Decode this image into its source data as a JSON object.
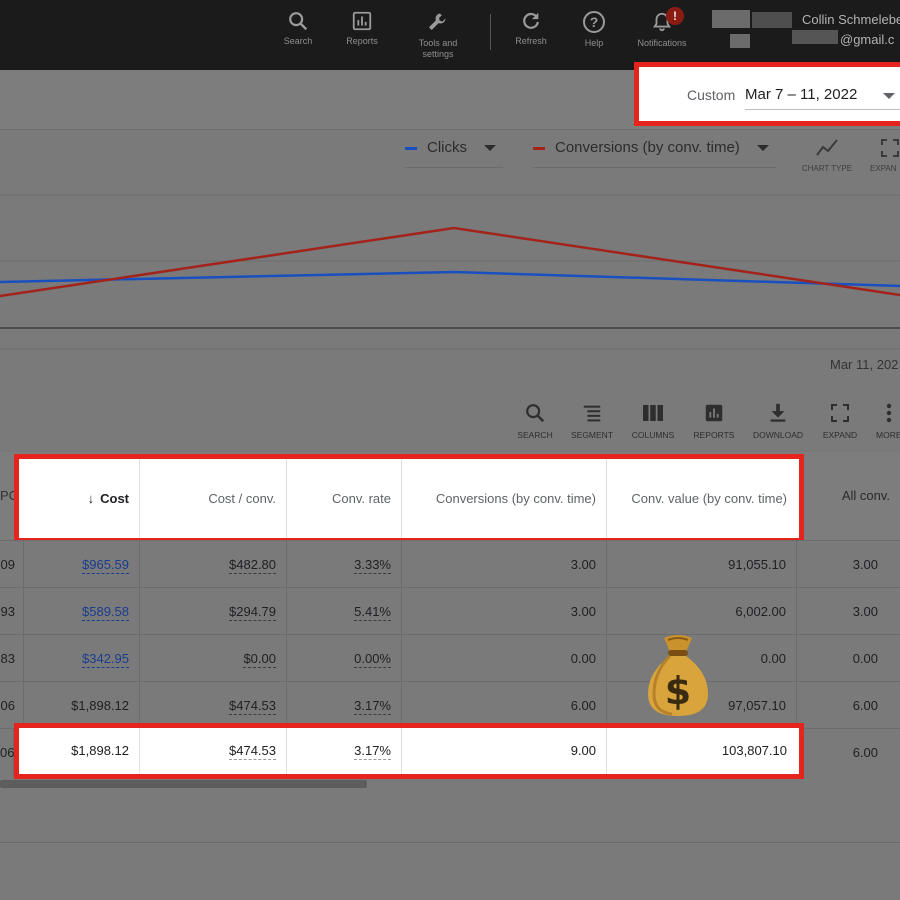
{
  "toolbar": {
    "search_label": "Search",
    "reports_label": "Reports",
    "tools_label_line1": "Tools and",
    "tools_label_line2": "settings",
    "refresh_label": "Refresh",
    "help_label": "Help",
    "notifications_label": "Notifications",
    "notifications_badge": "!",
    "account_name": "Collin Schmelebe",
    "account_email": "@gmail.c"
  },
  "date_range": {
    "preset": "Custom",
    "value": "Mar 7 – 11, 2022"
  },
  "chart_header": {
    "metric1": "Clicks",
    "metric1_color": "#1a4fbf",
    "metric2": "Conversions (by conv. time)",
    "metric2_color": "#a3231b",
    "chart_type_label": "CHART TYPE",
    "expand_label": "EXPAN"
  },
  "chart_data": {
    "type": "line",
    "x_end_label": "Mar 11, 202",
    "series": [
      {
        "name": "Clicks",
        "color": "#1a4fbf"
      },
      {
        "name": "Conversions (by conv. time)",
        "color": "#a3231b"
      }
    ]
  },
  "table_toolbar": {
    "search": "SEARCH",
    "segment": "SEGMENT",
    "columns": "COLUMNS",
    "reports": "REPORTS",
    "download": "DOWNLOAD",
    "expand": "EXPAND",
    "more": "MORE"
  },
  "table": {
    "left_cut_header": "PC",
    "headers": {
      "cost": "Cost",
      "cost_conv": "Cost / conv.",
      "conv_rate": "Conv. rate",
      "conversions": "Conversions (by conv. time)",
      "conv_value": "Conv. value (by conv. time)",
      "all_conv": "All conv."
    },
    "rows": [
      {
        "cut": "09",
        "cost": "$965.59",
        "cost_conv": "$482.80",
        "conv_rate": "3.33%",
        "conversions": "3.00",
        "conv_value": "91,055.10",
        "all_conv": "3.00"
      },
      {
        "cut": "93",
        "cost": "$589.58",
        "cost_conv": "$294.79",
        "conv_rate": "5.41%",
        "conversions": "3.00",
        "conv_value": "6,002.00",
        "all_conv": "3.00"
      },
      {
        "cut": "83",
        "cost": "$342.95",
        "cost_conv": "$0.00",
        "conv_rate": "0.00%",
        "conversions": "0.00",
        "conv_value": "0.00",
        "all_conv": "0.00"
      },
      {
        "cut": "06",
        "cost": "$1,898.12",
        "cost_conv": "$474.53",
        "conv_rate": "3.17%",
        "conversions": "6.00",
        "conv_value": "97,057.10",
        "all_conv": "6.00"
      }
    ],
    "total_row": {
      "cut": "06",
      "cost": "$1,898.12",
      "cost_conv": "$474.53",
      "conv_rate": "3.17%",
      "conversions": "9.00",
      "conv_value": "103,807.10",
      "all_conv": "6.00"
    }
  },
  "overlay": {
    "money_bag_symbol": "$",
    "highlight_color": "#e5251d"
  }
}
